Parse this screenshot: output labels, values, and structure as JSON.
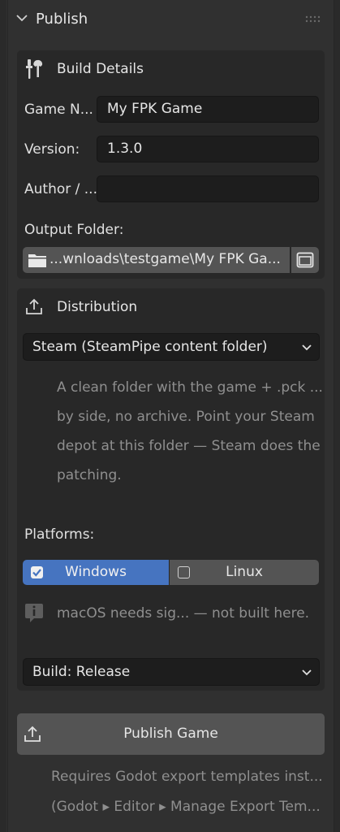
{
  "panel": {
    "title": "Publish"
  },
  "build_details": {
    "title": "Build Details",
    "game_name_label": "Game N...",
    "game_name_value": "My FPK Game",
    "version_label": "Version:",
    "version_value": "1.3.0",
    "author_label": "Author / ...",
    "author_value": "",
    "output_folder_label": "Output Folder:",
    "output_folder_value": "...wnloads\\testgame\\My FPK Ga..."
  },
  "distribution": {
    "title": "Distribution",
    "selected": "Steam (SteamPipe content folder)",
    "description_lines": [
      "A clean folder with the game + .pck ...",
      "by side, no archive. Point your Steam",
      "depot at this folder — Steam does the",
      "patching."
    ],
    "platforms_label": "Platforms:",
    "platforms": [
      {
        "label": "Windows",
        "checked": true
      },
      {
        "label": "Linux",
        "checked": false
      }
    ],
    "mac_note": "macOS needs sig... — not built here.",
    "build_selected": "Build: Release"
  },
  "publish": {
    "button_label": "Publish Game",
    "note_line1": "Requires Godot export templates inst...",
    "note_line2": "(Godot ▸ Editor ▸ Manage Export Tem..."
  },
  "colors": {
    "accent": "#4674c0",
    "panel": "#303030",
    "box": "#282828",
    "field": "#1d1d1d"
  },
  "icons": [
    "chevron-down-icon",
    "drag-grip-icon",
    "tools-icon",
    "folder-icon",
    "file-browser-icon",
    "upload-icon",
    "info-icon",
    "checkbox-icon",
    "dropdown-caret-icon"
  ]
}
